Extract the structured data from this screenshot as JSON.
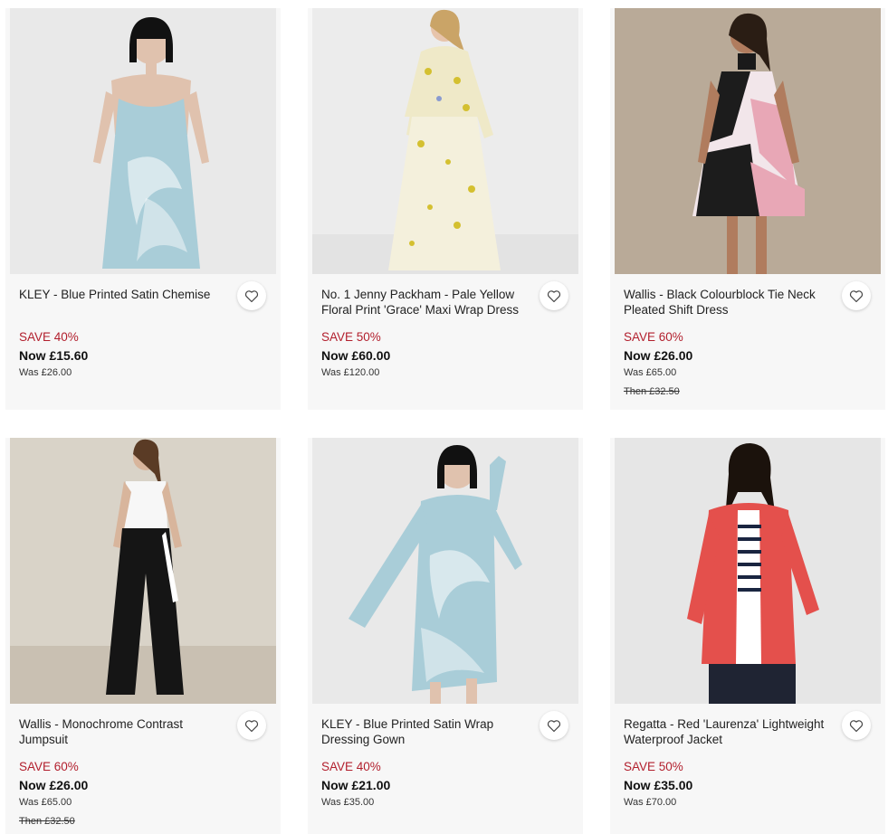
{
  "products": [
    {
      "title": "KLEY - Blue Printed Satin Chemise",
      "save": "SAVE 40%",
      "now": "Now £15.60",
      "was": "Was £26.00",
      "then": "",
      "image": "model in blue satin chemise",
      "bg": "#e9e9e9",
      "outfit": "#a9cdd8",
      "wishlist_icon": "heart-icon"
    },
    {
      "title": "No. 1 Jenny Packham - Pale Yellow Floral Print 'Grace' Maxi Wrap Dress",
      "save": "SAVE 50%",
      "now": "Now £60.00",
      "was": "Was £120.00",
      "then": "",
      "image": "model in pale yellow floral maxi dress",
      "bg": "#ececec",
      "outfit": "#efe9c8",
      "wishlist_icon": "heart-icon"
    },
    {
      "title": "Wallis - Black Colourblock Tie Neck Pleated Shift Dress",
      "save": "SAVE 60%",
      "now": "Now £26.00",
      "was": "Was £65.00",
      "then": "Then £32.50",
      "image": "model in pink and black pleated dress",
      "bg": "#b9aa98",
      "outfit": "#e8a7b6",
      "wishlist_icon": "heart-icon"
    },
    {
      "title": "Wallis - Monochrome Contrast Jumpsuit",
      "save": "SAVE 60%",
      "now": "Now £26.00",
      "was": "Was £65.00",
      "then": "Then £32.50",
      "image": "model in monochrome jumpsuit",
      "bg": "#d9d3c8",
      "outfit": "#151515",
      "wishlist_icon": "heart-icon"
    },
    {
      "title": "KLEY - Blue Printed Satin Wrap Dressing Gown",
      "save": "SAVE 40%",
      "now": "Now £21.00",
      "was": "Was £35.00",
      "then": "",
      "image": "model in blue satin dressing gown",
      "bg": "#e9e9e9",
      "outfit": "#a9cdd8",
      "wishlist_icon": "heart-icon"
    },
    {
      "title": "Regatta - Red 'Laurenza' Lightweight Waterproof Jacket",
      "save": "SAVE 50%",
      "now": "Now £35.00",
      "was": "Was £70.00",
      "then": "",
      "image": "model in red waterproof jacket",
      "bg": "#e6e6e6",
      "outfit": "#e4504c",
      "wishlist_icon": "heart-icon"
    }
  ]
}
